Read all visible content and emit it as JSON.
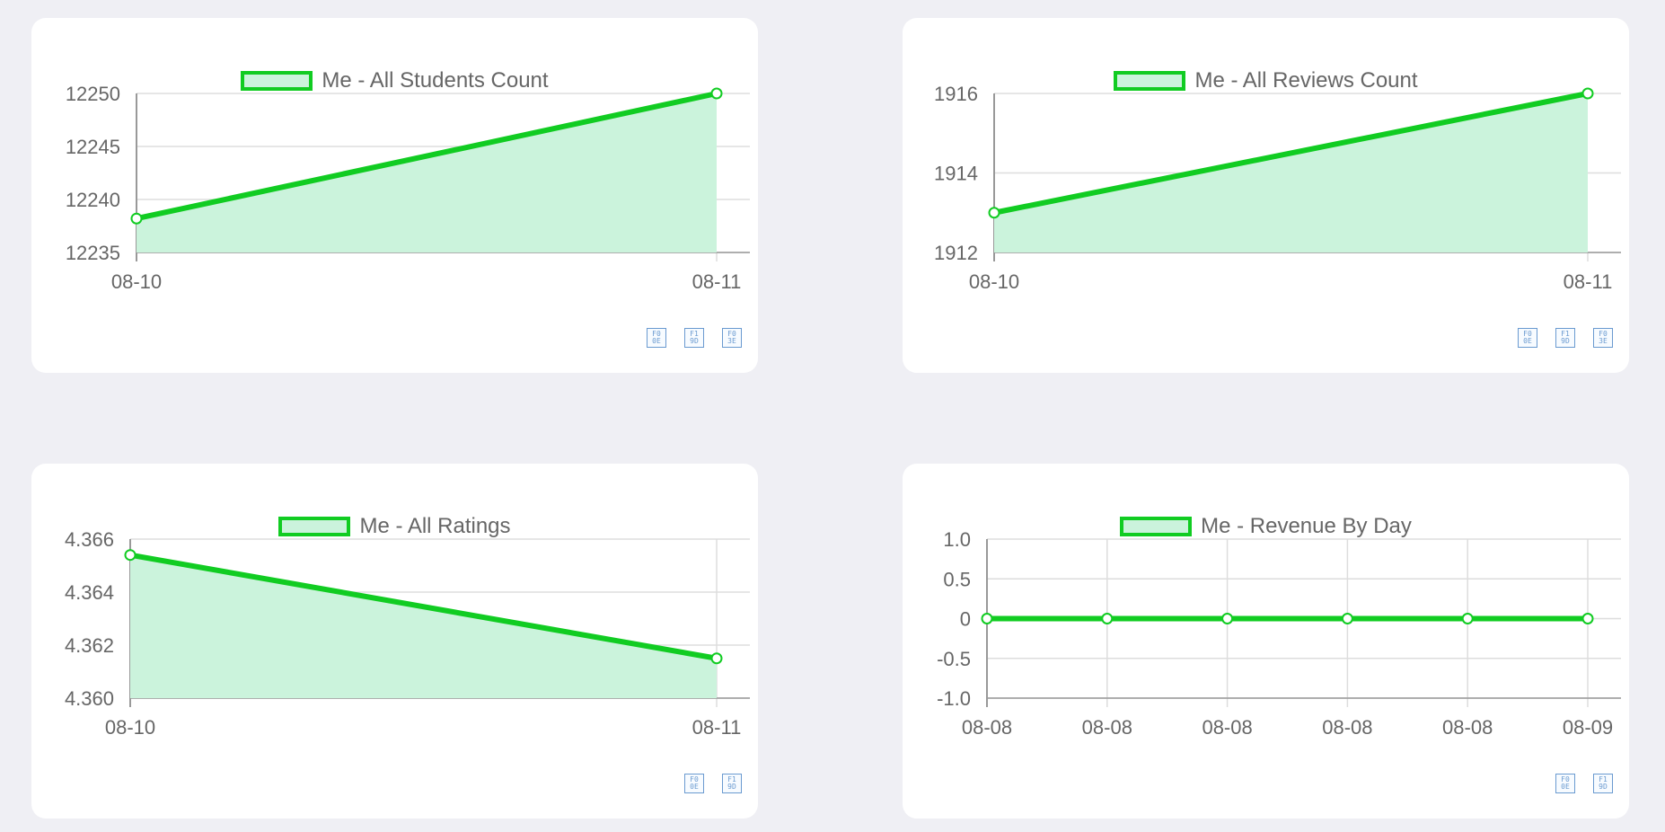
{
  "colors": {
    "page_background": "#efeff4",
    "card_background": "#ffffff",
    "line": "#11cc22",
    "area_fill": "#cbf3dc",
    "grid": "#dddddd",
    "axis": "#999999",
    "tick_text": "#666666",
    "toolbar_icon": "#6a9ad0"
  },
  "charts": [
    {
      "toolbar_icons": [
        {
          "name": "export-icon",
          "glyph": "F0\n0E"
        },
        {
          "name": "print-icon",
          "glyph": "F1\n9D"
        },
        {
          "name": "download-icon",
          "glyph": "F0\n3E"
        }
      ]
    },
    {
      "toolbar_icons": [
        {
          "name": "export-icon",
          "glyph": "F0\n0E"
        },
        {
          "name": "print-icon",
          "glyph": "F1\n9D"
        },
        {
          "name": "download-icon",
          "glyph": "F0\n3E"
        }
      ]
    },
    {
      "toolbar_icons": [
        {
          "name": "export-icon",
          "glyph": "F0\n0E"
        },
        {
          "name": "print-icon",
          "glyph": "F1\n9D"
        }
      ]
    },
    {
      "toolbar_icons": [
        {
          "name": "export-icon",
          "glyph": "F0\n0E"
        },
        {
          "name": "print-icon",
          "glyph": "F1\n9D"
        }
      ]
    }
  ],
  "chart_data": [
    {
      "type": "area",
      "categories": [
        "08-10",
        "08-11"
      ],
      "series": [
        {
          "name": "Me - All Students Count",
          "values": [
            12238.2,
            12250
          ]
        }
      ],
      "yticks": [
        12235,
        12240,
        12245,
        12250
      ],
      "ytick_labels": [
        "12235",
        "12240",
        "12245",
        "12250"
      ],
      "ylim": [
        12235,
        12250
      ],
      "grid": {
        "horizontal": true,
        "vertical": false
      },
      "legend": "top-center"
    },
    {
      "type": "area",
      "categories": [
        "08-10",
        "08-11"
      ],
      "series": [
        {
          "name": "Me - All Reviews Count",
          "values": [
            1913,
            1916
          ]
        }
      ],
      "yticks": [
        1912,
        1914,
        1916
      ],
      "ytick_labels": [
        "1912",
        "1914",
        "1916"
      ],
      "ylim": [
        1912,
        1916
      ],
      "grid": {
        "horizontal": true,
        "vertical": false
      },
      "legend": "top-center"
    },
    {
      "type": "area",
      "categories": [
        "08-10",
        "08-11"
      ],
      "series": [
        {
          "name": "Me - All Ratings",
          "values": [
            4.3654,
            4.3615
          ]
        }
      ],
      "yticks": [
        4.36,
        4.362,
        4.364,
        4.366
      ],
      "ytick_labels": [
        "4.360",
        "4.362",
        "4.364",
        "4.366"
      ],
      "ylim": [
        4.36,
        4.366
      ],
      "grid": {
        "horizontal": true,
        "vertical": true
      },
      "legend": "top-center"
    },
    {
      "type": "area",
      "categories": [
        "08-08",
        "08-08",
        "08-08",
        "08-08",
        "08-08",
        "08-09"
      ],
      "series": [
        {
          "name": "Me - Revenue By Day",
          "values": [
            0,
            0,
            0,
            0,
            0,
            0
          ]
        }
      ],
      "yticks": [
        -1,
        -0.5,
        0,
        0.5,
        1
      ],
      "ytick_labels": [
        "-1.0",
        "-0.5",
        "0",
        "0.5",
        "1.0"
      ],
      "ylim": [
        -1,
        1
      ],
      "grid": {
        "horizontal": true,
        "vertical": true
      },
      "legend": "top-center"
    }
  ]
}
